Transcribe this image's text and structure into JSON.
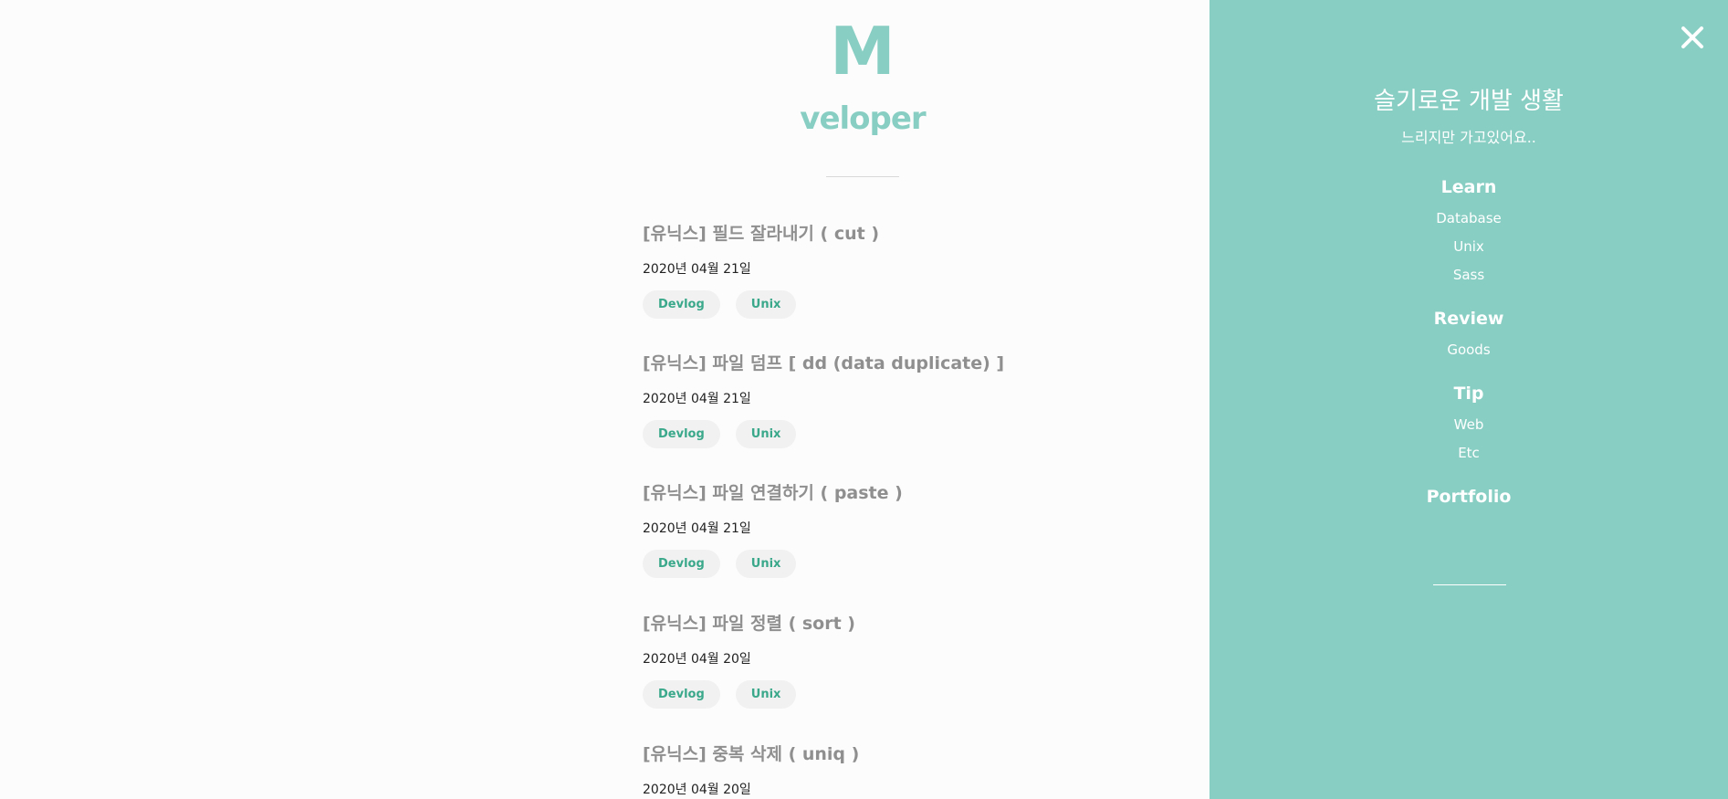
{
  "brand": {
    "logo_mark": "M",
    "logo_text": "veloper"
  },
  "posts": [
    {
      "title": "[유닉스] 필드 잘라내기 ( cut )",
      "date": "2020년 04월 21일",
      "tags": [
        "Devlog",
        "Unix"
      ]
    },
    {
      "title": "[유닉스] 파일 덤프 [ dd (data duplicate) ]",
      "date": "2020년 04월 21일",
      "tags": [
        "Devlog",
        "Unix"
      ]
    },
    {
      "title": "[유닉스] 파일 연결하기 ( paste )",
      "date": "2020년 04월 21일",
      "tags": [
        "Devlog",
        "Unix"
      ]
    },
    {
      "title": "[유닉스] 파일 정렬 ( sort )",
      "date": "2020년 04월 20일",
      "tags": [
        "Devlog",
        "Unix"
      ]
    },
    {
      "title": "[유닉스] 중복 삭제 ( uniq )",
      "date": "2020년 04월 20일",
      "tags": []
    }
  ],
  "sidebar": {
    "close_icon": "close-icon",
    "title": "슬기로운 개발 생활",
    "subtitle": "느리지만 가고있어요..",
    "sections": [
      {
        "heading": "Learn",
        "items": [
          "Database",
          "Unix",
          "Sass"
        ]
      },
      {
        "heading": "Review",
        "items": [
          "Goods"
        ]
      },
      {
        "heading": "Tip",
        "items": [
          "Web",
          "Etc"
        ]
      },
      {
        "heading": "Portfolio",
        "items": []
      }
    ]
  },
  "colors": {
    "accent": "#88cec3",
    "tag_text": "#3aa88a",
    "tag_bg": "#f1f1f1",
    "post_title": "#8f8f8f"
  }
}
